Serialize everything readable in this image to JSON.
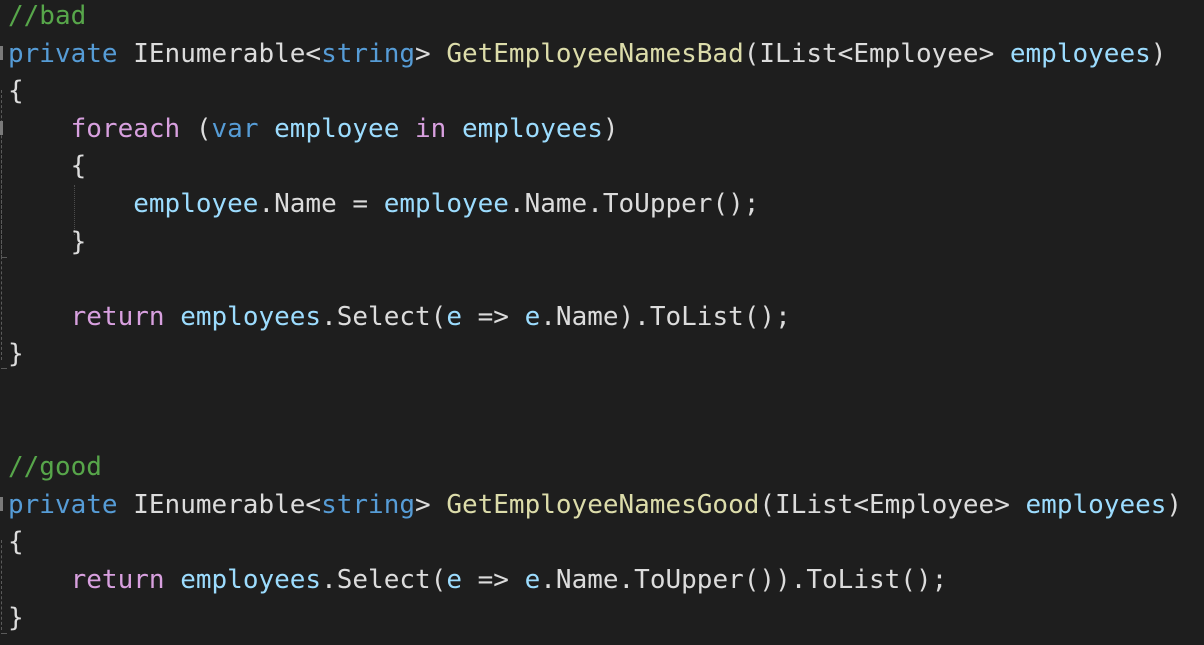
{
  "editor": {
    "theme_colors": {
      "background": "#1e1e1e",
      "comment": "#57a64a",
      "keyword": "#569cd6",
      "control_keyword": "#d8a0df",
      "method": "#dcdcaa",
      "identifier": "#9cdcfe",
      "plain": "#dcdcdc"
    },
    "lines": [
      [
        {
          "t": "//bad",
          "c": "comment"
        }
      ],
      [
        {
          "t": "private",
          "c": "keyword"
        },
        {
          "t": " ",
          "c": "plain"
        },
        {
          "t": "IEnumerable",
          "c": "type"
        },
        {
          "t": "<",
          "c": "punct"
        },
        {
          "t": "string",
          "c": "keyword"
        },
        {
          "t": "> ",
          "c": "punct"
        },
        {
          "t": "GetEmployeeNamesBad",
          "c": "method"
        },
        {
          "t": "(",
          "c": "punct"
        },
        {
          "t": "IList",
          "c": "type"
        },
        {
          "t": "<",
          "c": "punct"
        },
        {
          "t": "Employee",
          "c": "type"
        },
        {
          "t": "> ",
          "c": "punct"
        },
        {
          "t": "employees",
          "c": "param"
        },
        {
          "t": ")",
          "c": "punct"
        }
      ],
      [
        {
          "t": "{",
          "c": "punct"
        }
      ],
      [
        {
          "t": "    ",
          "c": "plain"
        },
        {
          "t": "foreach",
          "c": "control"
        },
        {
          "t": " (",
          "c": "punct"
        },
        {
          "t": "var",
          "c": "keyword"
        },
        {
          "t": " ",
          "c": "plain"
        },
        {
          "t": "employee",
          "c": "local"
        },
        {
          "t": " ",
          "c": "plain"
        },
        {
          "t": "in",
          "c": "control"
        },
        {
          "t": " ",
          "c": "plain"
        },
        {
          "t": "employees",
          "c": "param"
        },
        {
          "t": ")",
          "c": "punct"
        }
      ],
      [
        {
          "t": "    {",
          "c": "punct"
        }
      ],
      [
        {
          "t": "        ",
          "c": "plain"
        },
        {
          "t": "employee",
          "c": "local"
        },
        {
          "t": ".Name = ",
          "c": "plain"
        },
        {
          "t": "employee",
          "c": "local"
        },
        {
          "t": ".Name.",
          "c": "plain"
        },
        {
          "t": "ToUpper",
          "c": "plain"
        },
        {
          "t": "();",
          "c": "punct"
        }
      ],
      [
        {
          "t": "    }",
          "c": "punct"
        }
      ],
      [
        {
          "t": "",
          "c": "plain"
        }
      ],
      [
        {
          "t": "    ",
          "c": "plain"
        },
        {
          "t": "return",
          "c": "control"
        },
        {
          "t": " ",
          "c": "plain"
        },
        {
          "t": "employees",
          "c": "param"
        },
        {
          "t": ".Select(",
          "c": "plain"
        },
        {
          "t": "e",
          "c": "param"
        },
        {
          "t": " => ",
          "c": "plain"
        },
        {
          "t": "e",
          "c": "param"
        },
        {
          "t": ".Name).ToList();",
          "c": "plain"
        }
      ],
      [
        {
          "t": "}",
          "c": "punct"
        }
      ],
      [
        {
          "t": "",
          "c": "plain"
        }
      ],
      [
        {
          "t": "",
          "c": "plain"
        }
      ],
      [
        {
          "t": "//good",
          "c": "comment"
        }
      ],
      [
        {
          "t": "private",
          "c": "keyword"
        },
        {
          "t": " ",
          "c": "plain"
        },
        {
          "t": "IEnumerable",
          "c": "type"
        },
        {
          "t": "<",
          "c": "punct"
        },
        {
          "t": "string",
          "c": "keyword"
        },
        {
          "t": "> ",
          "c": "punct"
        },
        {
          "t": "GetEmployeeNamesGood",
          "c": "method"
        },
        {
          "t": "(",
          "c": "punct"
        },
        {
          "t": "IList",
          "c": "type"
        },
        {
          "t": "<",
          "c": "punct"
        },
        {
          "t": "Employee",
          "c": "type"
        },
        {
          "t": "> ",
          "c": "punct"
        },
        {
          "t": "employees",
          "c": "param"
        },
        {
          "t": ")",
          "c": "punct"
        }
      ],
      [
        {
          "t": "{",
          "c": "punct"
        }
      ],
      [
        {
          "t": "    ",
          "c": "plain"
        },
        {
          "t": "return",
          "c": "control"
        },
        {
          "t": " ",
          "c": "plain"
        },
        {
          "t": "employees",
          "c": "param"
        },
        {
          "t": ".Select(",
          "c": "plain"
        },
        {
          "t": "e",
          "c": "param"
        },
        {
          "t": " => ",
          "c": "plain"
        },
        {
          "t": "e",
          "c": "param"
        },
        {
          "t": ".Name.ToUpper()).ToList();",
          "c": "plain"
        }
      ],
      [
        {
          "t": "}",
          "c": "punct"
        }
      ]
    ]
  }
}
